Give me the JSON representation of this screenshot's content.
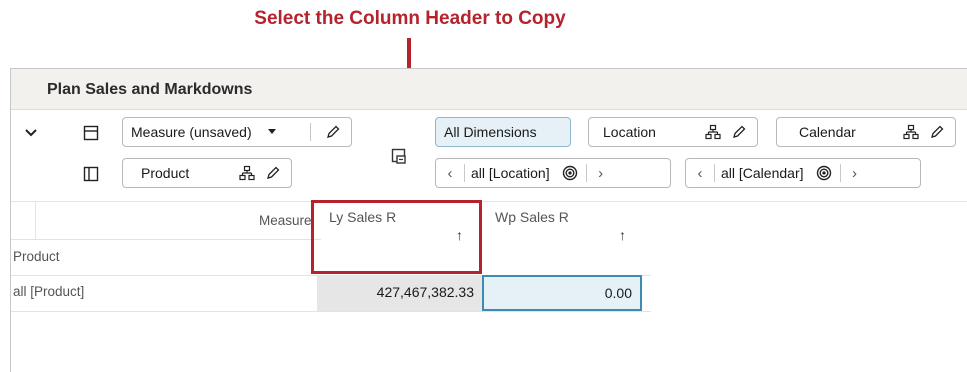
{
  "callout": {
    "title": "Select the Column Header to Copy"
  },
  "panel": {
    "title": "Plan Sales and Markdowns"
  },
  "toolbar": {
    "measure_label": "Measure (unsaved)",
    "product_label": "Product",
    "all_dimensions_label": "All Dimensions",
    "location_label": "Location",
    "calendar_label": "Calendar",
    "location_nav_value": "all [Location]",
    "calendar_nav_value": "all [Calendar]"
  },
  "grid": {
    "measure_header": "Measure",
    "row_dim_header": "Product",
    "columns": [
      {
        "label": "Ly Sales R",
        "sort_glyph": "↑"
      },
      {
        "label": "Wp Sales R",
        "sort_glyph": "↑"
      }
    ],
    "rows": [
      {
        "label": "all [Product]",
        "values": [
          "427,467,382.33",
          "0.00"
        ]
      }
    ]
  },
  "colors": {
    "accent_red": "#b5232d",
    "selected_cell_bg": "#e5f1f6",
    "selected_cell_border": "#3d8bb0",
    "readonly_cell_bg": "#e6e6e6"
  }
}
